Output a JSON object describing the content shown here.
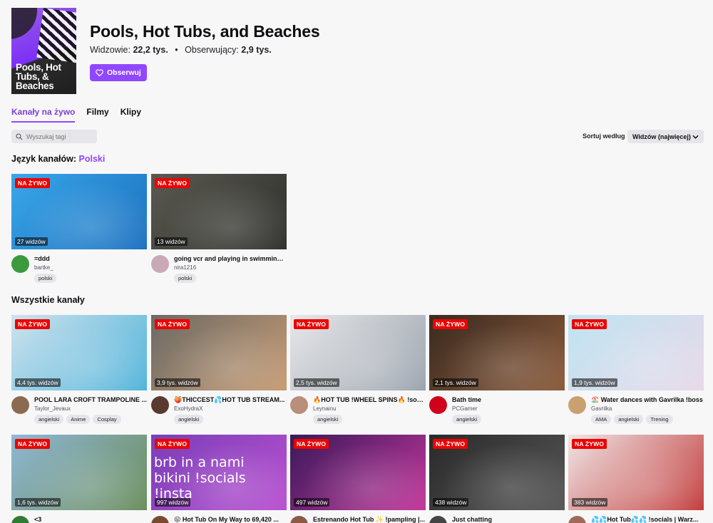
{
  "game": {
    "title": "Pools, Hot Tubs, and Beaches",
    "boxart_text": "Pools, Hot Tubs, & Beaches",
    "viewers_label": "Widzowie:",
    "viewers_value": "22,2 tys.",
    "followers_label": "Obserwujący:",
    "followers_value": "2,9 tys.",
    "follow_label": "Obserwuj"
  },
  "tabs": [
    "Kanały na żywo",
    "Filmy",
    "Klipy"
  ],
  "search": {
    "placeholder": "Wyszukaj tagi"
  },
  "sort": {
    "label": "Sortuj według",
    "value": "Widzów (najwięcej)"
  },
  "language_section": {
    "label": "Język kanałów:",
    "value": "Polski"
  },
  "all_section": {
    "label": "Wszystkie kanały"
  },
  "badge_label": "NA ŻYWO",
  "language_streams": [
    {
      "title": "=ddd",
      "channel": "bartke_",
      "viewers": "27 widzów",
      "tags": [
        "polski"
      ],
      "colors": [
        "#3aa7e8",
        "#1a6fbf"
      ],
      "avatar": "#3c9a3c"
    },
    {
      "title": "going vcr and playing in swimming ...",
      "channel": "nira1216",
      "viewers": "13 widzów",
      "tags": [
        "polski"
      ],
      "colors": [
        "#5a5a52",
        "#2e2f2a"
      ],
      "avatar": "#c9a9b6"
    }
  ],
  "all_streams_row1": [
    {
      "title": "POOL LARA CROFT TRAMPOLINE ...",
      "channel": "Taylor_Jevaux",
      "viewers": "4,4 tys. widzów",
      "tags": [
        "angielski",
        "Anime",
        "Cosplay"
      ],
      "colors": [
        "#cfe3ee",
        "#4fb3d9"
      ],
      "avatar": "#8a6b52"
    },
    {
      "title": "🍑THICCEST💦HOT TUB STREAM...",
      "channel": "ExoHydraX",
      "viewers": "3,9 tys. widzów",
      "tags": [
        "angielski"
      ],
      "colors": [
        "#6b6b66",
        "#c79a72"
      ],
      "avatar": "#5a3a2f"
    },
    {
      "title": "🔥HOT TUB !WHEEL SPINS🔥 !socia...",
      "channel": "Leynainu",
      "viewers": "2,5 tys. widzów",
      "tags": [
        "angielski"
      ],
      "colors": [
        "#e8e8ea",
        "#9aa3ad"
      ],
      "avatar": "#b98e7a"
    },
    {
      "title": "Bath time",
      "channel": "PCGamer",
      "viewers": "2,1 tys. widzów",
      "tags": [
        "angielski"
      ],
      "colors": [
        "#3a2a20",
        "#8b5a3a"
      ],
      "avatar": "#d0021b"
    },
    {
      "title": "🏖️ Water dances with Gavrilka !boss",
      "channel": "Gavrilka",
      "viewers": "1,9 tys. widzów",
      "tags": [
        "AMA",
        "angielski",
        "Trening"
      ],
      "colors": [
        "#bfe4f2",
        "#e7d8e8"
      ],
      "avatar": "#c9a070"
    }
  ],
  "all_streams_row2": [
    {
      "title": "<3",
      "viewers": "1,6 tys. widzów",
      "colors": [
        "#8fb8d6",
        "#6a8c5a"
      ],
      "avatar": "#2e7d32"
    },
    {
      "title": "😛 Hot Tub On My Way to 69,420 ...",
      "viewers": "997 widzów",
      "colors": [
        "#7a3fb8",
        "#b84fd0"
      ],
      "avatar": "#7a4a2e",
      "overlay": "brb in a nami bikini !socials !insta"
    },
    {
      "title": "Estrenando Hot Tub ✨ !pampling |...",
      "viewers": "497 widzów",
      "colors": [
        "#3a1a5a",
        "#c2349a"
      ],
      "avatar": "#8c5a46"
    },
    {
      "title": "Just chatting",
      "viewers": "438 widzów",
      "colors": [
        "#2a2a2a",
        "#555555"
      ],
      "avatar": "#444444"
    },
    {
      "title": "💦💦Hot Tub💦💦 !socials | Warz...",
      "viewers": "383 widzów",
      "colors": [
        "#f0e6e6",
        "#c23a3a"
      ],
      "avatar": "#a06a5a"
    }
  ],
  "colors": {
    "accent": "#9147ff",
    "live": "#eb0400"
  }
}
